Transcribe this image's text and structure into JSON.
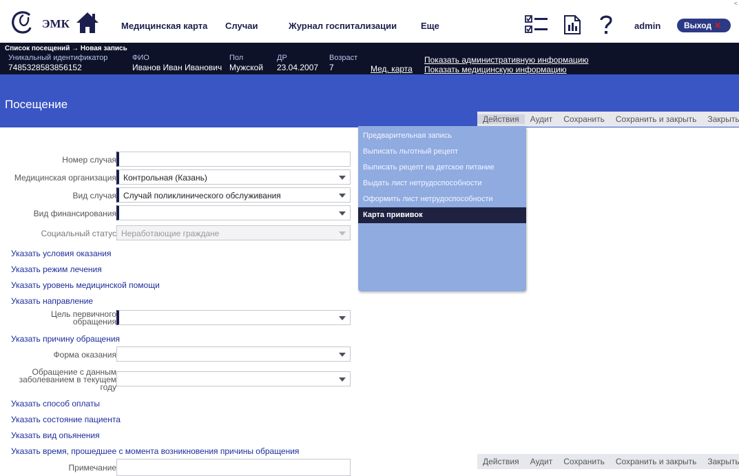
{
  "header": {
    "logo_text": "ЭМК",
    "nav": [
      "Медицинская карта",
      "Случаи",
      "Журнал госпитализации",
      "Еще"
    ],
    "user": "admin",
    "logout_label": "Выход",
    "logout_x": "✕"
  },
  "patient": {
    "breadcrumb": "Список посещений → Новая запись",
    "id_label": "Уникальный идентификатор",
    "id_value": "7485328583856152",
    "name_label": "ФИО",
    "name_value": "Иванов Иван Иванович",
    "sex_label": "Пол",
    "sex_value": "Мужской",
    "dob_label": "ДР",
    "dob_value": "23.04.2007",
    "age_label": "Возраст",
    "age_value": "7",
    "med_card_link": "Мед. карта",
    "admin_info_link": "Показать административную информацию",
    "med_info_link": "Показать медицинскую информацию"
  },
  "page": {
    "title": "Посещение"
  },
  "toolbar": {
    "actions": "Действия",
    "audit": "Аудит",
    "save": "Сохранить",
    "save_close": "Сохранить и закрыть",
    "close": "Закрыть"
  },
  "actions_menu": {
    "items": [
      "Предварительная запись",
      "Выписать льготный рецепт",
      "Выписать рецепт на детское питание",
      "Выдать лист нетрудоспособности",
      "Оформить лист нетрудоспособности",
      "Карта прививок"
    ],
    "selected": "Карта прививок"
  },
  "form": {
    "case_number": {
      "label": "Номер случая",
      "value": ""
    },
    "med_org": {
      "label": "Медицинская организация",
      "value": "Контрольная (Казань)"
    },
    "case_type": {
      "label": "Вид случая",
      "value": "Случай поликлинического обслуживания"
    },
    "financing": {
      "label": "Вид финансирования",
      "value": ""
    },
    "social_status": {
      "label": "Социальный статус",
      "value": "Неработающие граждане"
    },
    "link_conditions": "Указать условия оказания",
    "link_mode": "Указать режим лечения",
    "link_level": "Указать уровень медицинской помощи",
    "link_direction": "Указать направление",
    "primary_goal": {
      "label_line1": "Цель первичного",
      "label_line2": "обращения",
      "value": ""
    },
    "link_reason": "Указать причину обращения",
    "form_type": {
      "label": "Форма оказания",
      "value": ""
    },
    "disease_visit": {
      "label_line1": "Обращение с данным",
      "label_line2": "заболеванием в текущем",
      "label_line3": "году",
      "value": ""
    },
    "link_payment": "Указать способ оплаты",
    "link_state": "Указать состояние пациента",
    "link_intoxication": "Указать вид опьянения",
    "link_time": "Указать время, прошедшее с момента возникновения причины обращения",
    "note": {
      "label": "Примечание",
      "value": ""
    }
  }
}
